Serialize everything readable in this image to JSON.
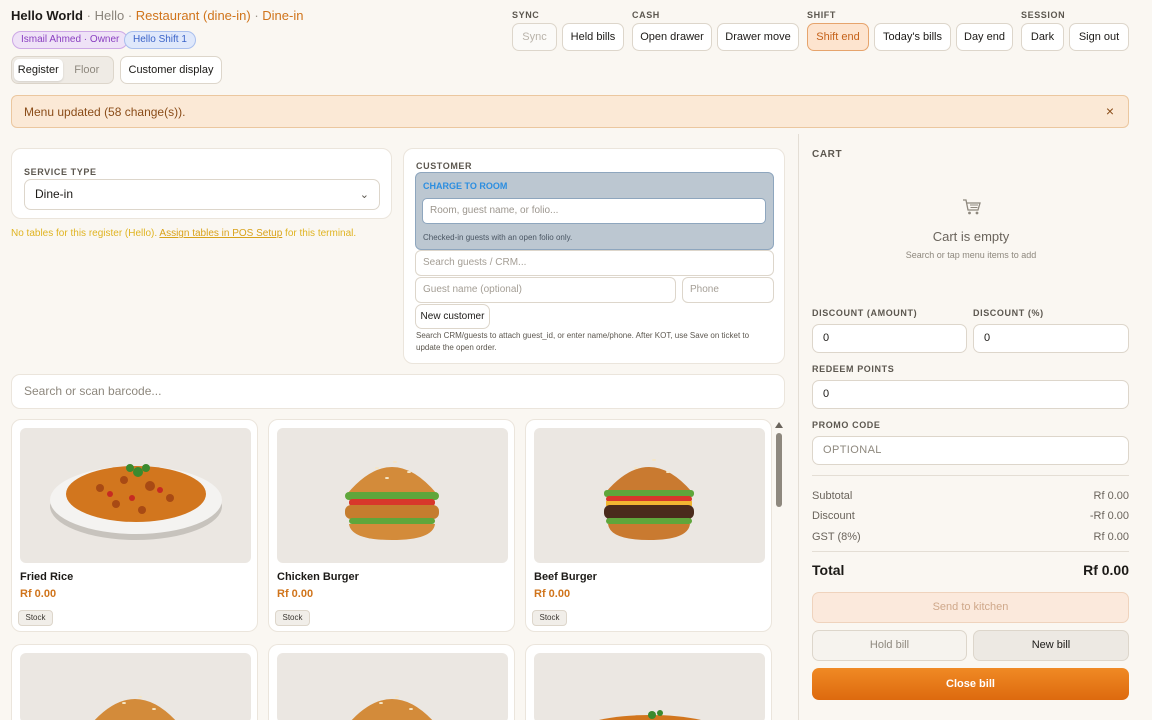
{
  "header": {
    "brand_name": "Hello World",
    "location": "Hello",
    "outlet": "Restaurant (dine-in)",
    "mode": "Dine-in",
    "user_badge": "Ismail Ahmed · Owner",
    "shift_badge": "Hello Shift 1",
    "view_tabs": [
      "Register",
      "Floor"
    ],
    "customer_display": "Customer display"
  },
  "toolbar": {
    "groups": {
      "sync": "SYNC",
      "cash": "CASH",
      "shift": "SHIFT",
      "session": "SESSION"
    },
    "sync": "Sync",
    "held_bills": "Held bills",
    "open_drawer": "Open drawer",
    "drawer_move": "Drawer move",
    "shift_end": "Shift end",
    "todays_bills": "Today's bills",
    "day_end": "Day end",
    "dark": "Dark",
    "sign_out": "Sign out"
  },
  "banner": {
    "text": "Menu updated (58 change(s)).",
    "close": "×"
  },
  "service": {
    "label": "SERVICE TYPE",
    "value": "Dine-in",
    "notice_pre": "No tables for this register (Hello).",
    "notice_link": "Assign tables in POS Setup",
    "notice_post": "for this terminal."
  },
  "customer": {
    "label": "CUSTOMER",
    "charge_label": "CHARGE TO ROOM",
    "room_placeholder": "Room, guest name, or folio...",
    "room_hint": "Checked-in guests with an open folio only.",
    "search_placeholder": "Search guests / CRM...",
    "guest_placeholder": "Guest name (optional)",
    "phone_placeholder": "Phone",
    "new_customer": "New customer",
    "help": "Search CRM/guests to attach guest_id, or enter name/phone. After KOT, use Save on ticket to update the open order."
  },
  "search": {
    "placeholder": "Search or scan barcode..."
  },
  "products": [
    {
      "name": "Fried Rice",
      "price": "Rf 0.00",
      "stock": "Stock",
      "image": "fried-rice"
    },
    {
      "name": "Chicken Burger",
      "price": "Rf 0.00",
      "stock": "Stock",
      "image": "chicken-burger"
    },
    {
      "name": "Beef Burger",
      "price": "Rf 0.00",
      "stock": "Stock",
      "image": "beef-burger"
    }
  ],
  "cart": {
    "title": "CART",
    "empty": "Cart is empty",
    "empty_sub": "Search or tap menu items to add",
    "discount_amount_label": "DISCOUNT (AMOUNT)",
    "discount_amount": "0",
    "discount_pct_label": "DISCOUNT (%)",
    "discount_pct": "0",
    "redeem_label": "REDEEM POINTS",
    "redeem": "0",
    "promo_label": "PROMO CODE",
    "promo_placeholder": "OPTIONAL",
    "subtotal_label": "Subtotal",
    "subtotal": "Rf 0.00",
    "discount_label": "Discount",
    "discount": "-Rf 0.00",
    "gst_label": "GST (8%)",
    "gst": "Rf 0.00",
    "total_label": "Total",
    "total": "Rf 0.00",
    "send_kitchen": "Send to kitchen",
    "hold_bill": "Hold bill",
    "new_bill": "New bill",
    "close_bill": "Close bill"
  },
  "colors": {
    "accent": "#d0741b",
    "background": "#faf7f2"
  }
}
